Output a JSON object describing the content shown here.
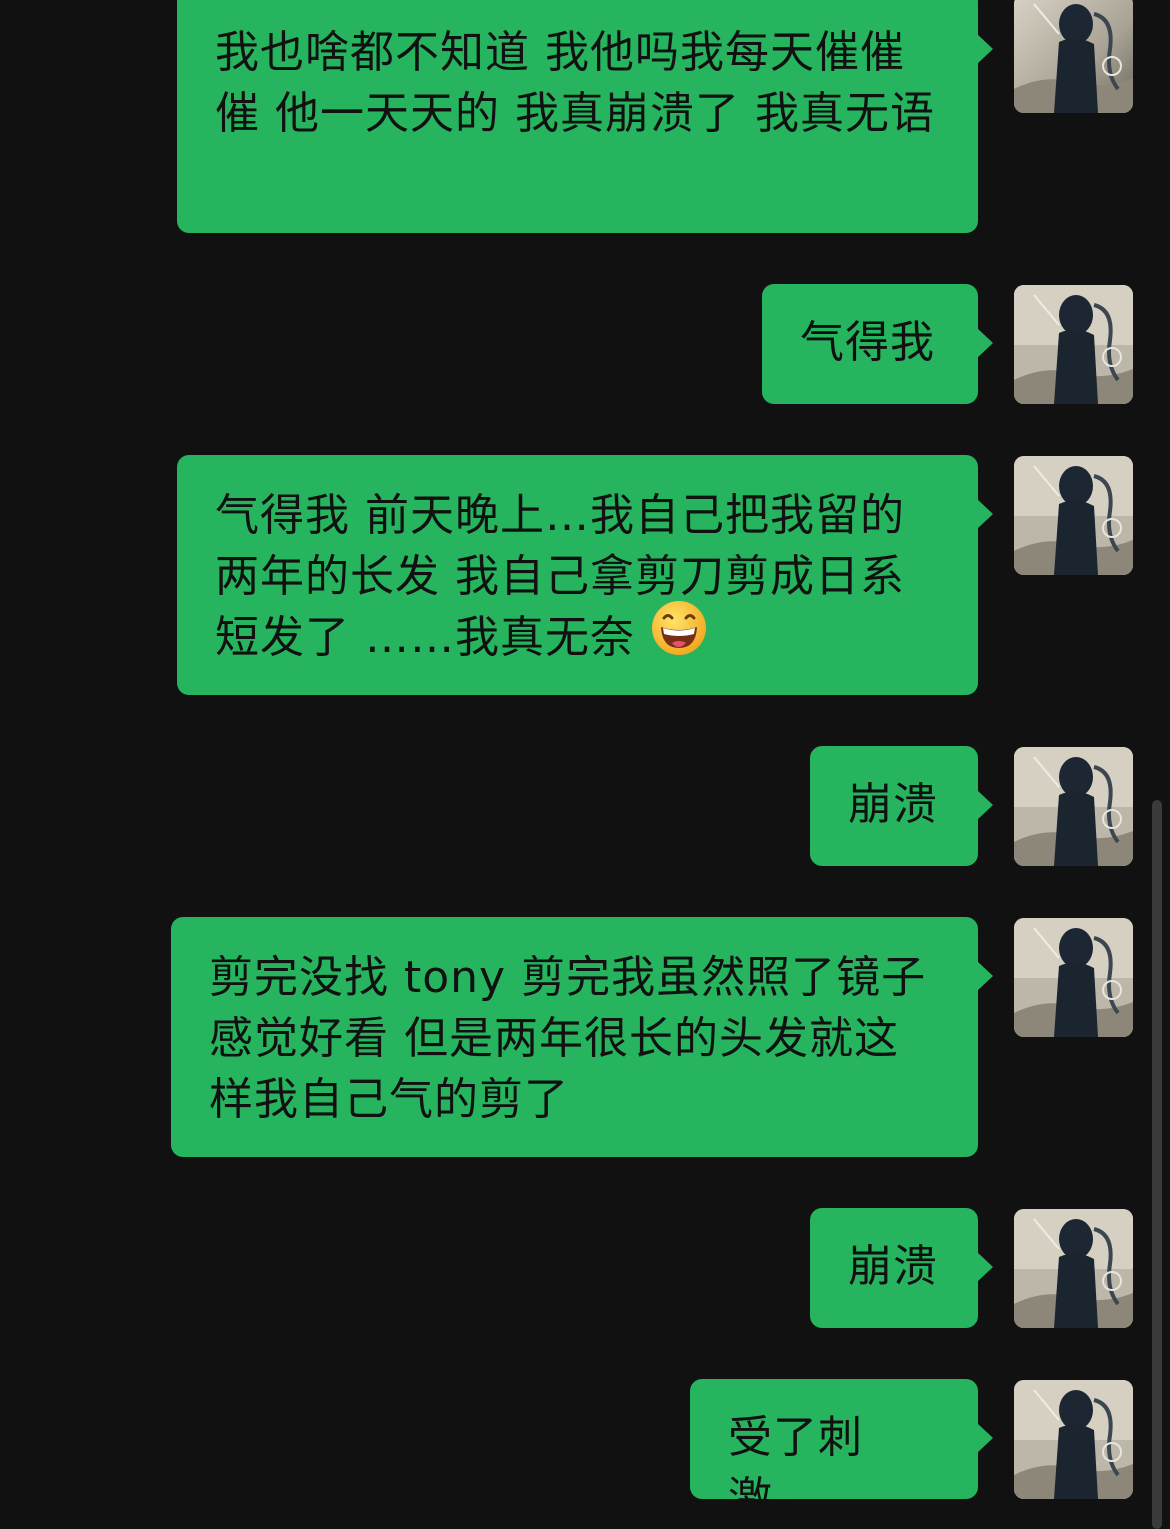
{
  "messages": [
    {
      "text": "我也啥都不知道 我他吗我每天催催催 他一天天的 我真崩溃了 我真无语",
      "emoji": ""
    },
    {
      "text": "气得我",
      "emoji": ""
    },
    {
      "text": "气得我 前天晚上…我自己把我留的两年的长发 我自己拿剪刀剪成日系短发了 ……我真无奈",
      "emoji": "grinning-face-emoji"
    },
    {
      "text": "崩溃",
      "emoji": ""
    },
    {
      "text": "剪完没找 tony 剪完我虽然照了镜子感觉好看 但是两年很长的头发就这样我自己气的剪了",
      "emoji": ""
    },
    {
      "text": "崩溃",
      "emoji": ""
    },
    {
      "text": "受了刺激。",
      "emoji": ""
    }
  ],
  "colors": {
    "background": "#111111",
    "bubble": "#26b45f",
    "text": "#111111"
  },
  "icons": {
    "avatar": "avatar-dark-figure-image",
    "emoji": "grinning-face-emoji"
  }
}
